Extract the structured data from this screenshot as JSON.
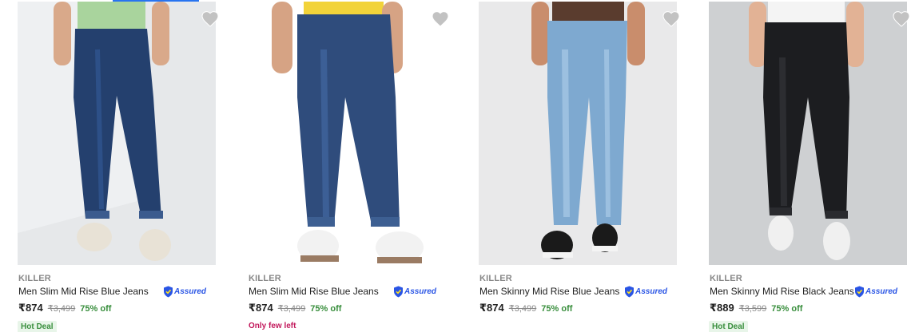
{
  "products": [
    {
      "brand": "KILLER",
      "title": "Men Slim Mid Rise Blue Jeans",
      "assured": "Assured",
      "price": "₹874",
      "mrp": "₹3,499",
      "discount": "75% off",
      "tag": "Hot Deal",
      "tag_type": "hot",
      "image": {
        "background": "#e6e8ea",
        "jeans": "#24406e",
        "shirt": "#a9d49d",
        "shoe": "#e8e2d6"
      }
    },
    {
      "brand": "KILLER",
      "title": "Men Slim Mid Rise Blue Jeans",
      "assured": "Assured",
      "price": "₹874",
      "mrp": "₹3,499",
      "discount": "75% off",
      "tag": "Only few left",
      "tag_type": "few",
      "image": {
        "background": "#ffffff",
        "jeans": "#2f4c7c",
        "shirt": "#f2d33a",
        "shoe": "#f2f2f2"
      }
    },
    {
      "brand": "KILLER",
      "title": "Men Skinny Mid Rise Blue Jeans",
      "assured": "Assured",
      "price": "₹874",
      "mrp": "₹3,499",
      "discount": "75% off",
      "tag": "",
      "tag_type": "none",
      "image": {
        "background": "#e9e9ea",
        "jeans": "#7ea9d0",
        "shirt": "#5a3c2e",
        "shoe": "#1a1a1a"
      }
    },
    {
      "brand": "KILLER",
      "title": "Men Skinny Mid Rise Black Jeans",
      "assured": "Assured",
      "price": "₹889",
      "mrp": "₹3,599",
      "discount": "75% off",
      "tag": "Hot Deal",
      "tag_type": "hot",
      "image": {
        "background": "#ced0d2",
        "jeans": "#1c1d20",
        "shirt": "#f4f4f4",
        "shoe": "#f0f0f0"
      }
    }
  ],
  "colors": {
    "accent": "#2874f0",
    "discount_green": "#388e3c",
    "hot_deal_bg": "#e8f5e9",
    "few_left_pink": "#c2185b",
    "wishlist_heart": "#c2c2c2"
  },
  "icons": {
    "wishlist": "heart-icon",
    "assured": "assured-badge-icon"
  }
}
